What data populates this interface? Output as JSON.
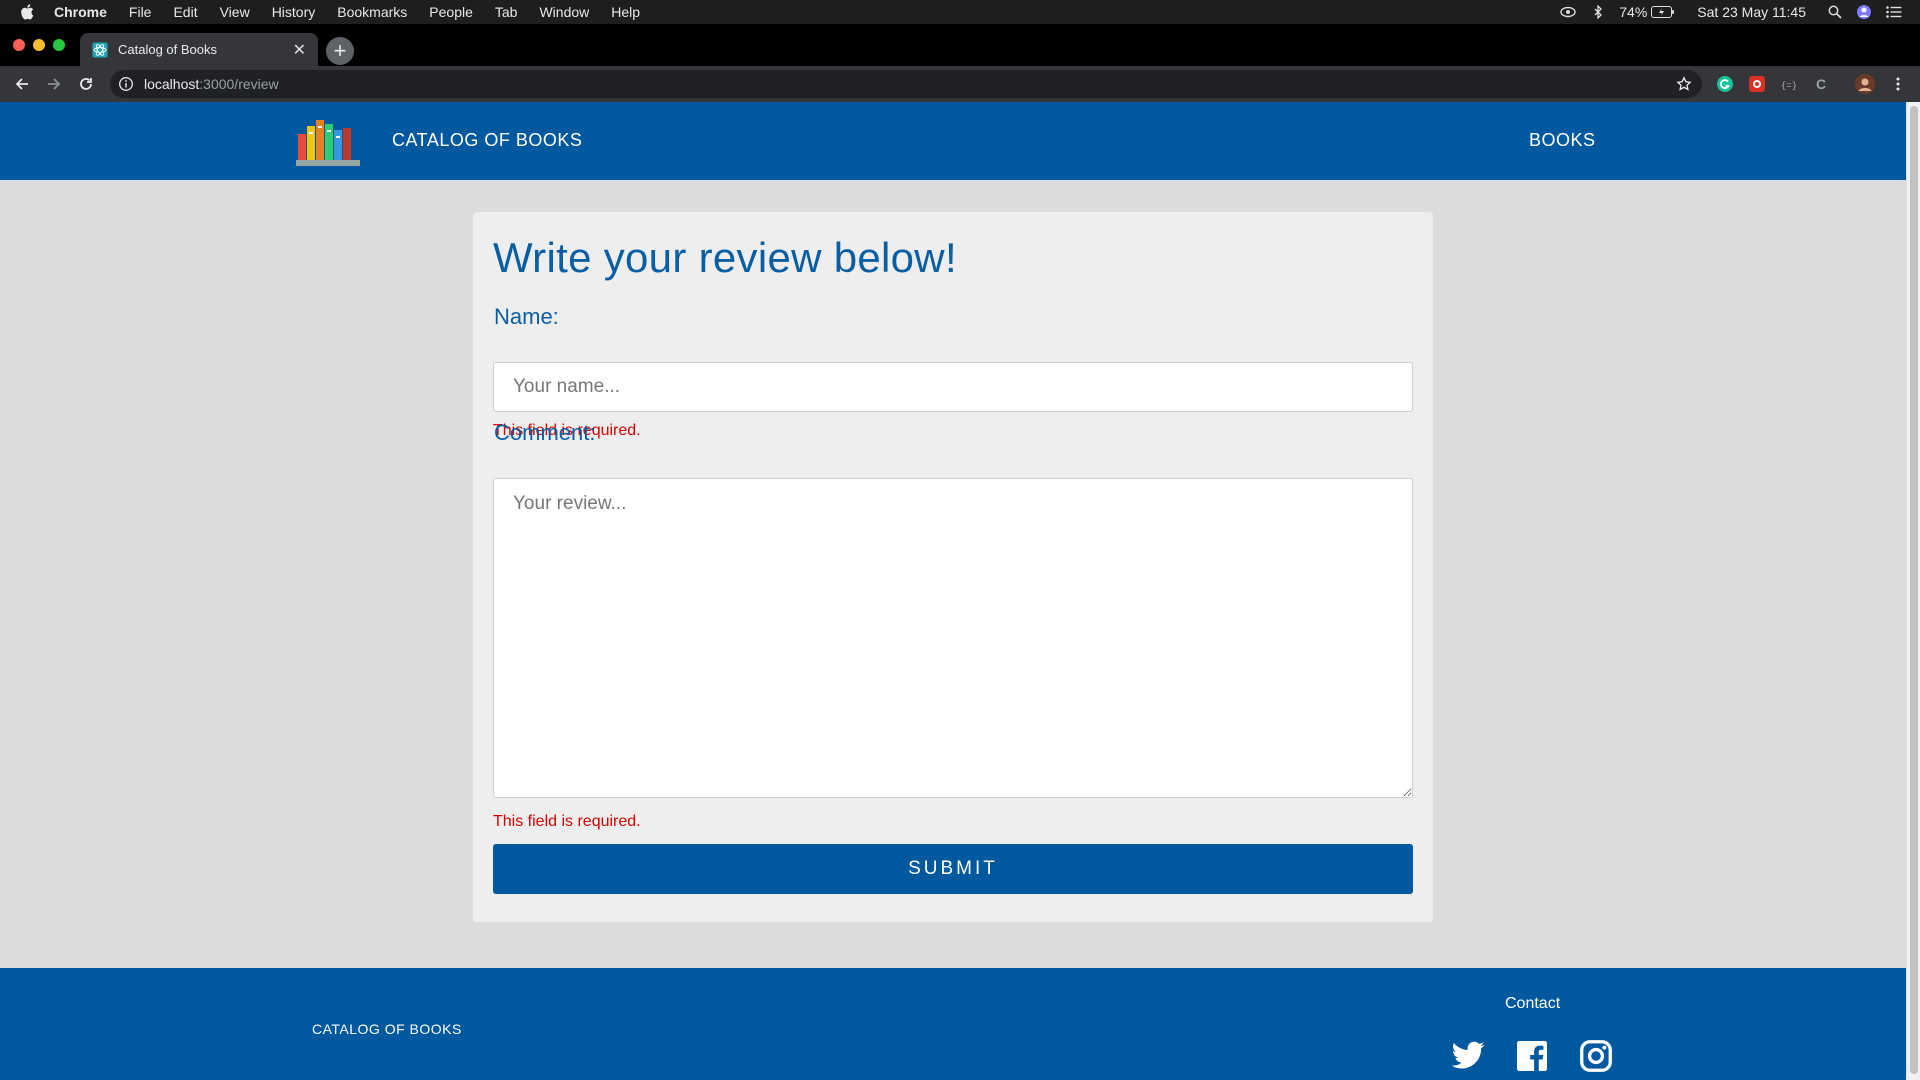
{
  "menubar": {
    "app": "Chrome",
    "items": [
      "File",
      "Edit",
      "View",
      "History",
      "Bookmarks",
      "People",
      "Tab",
      "Window",
      "Help"
    ],
    "battery": "74%",
    "clock": "Sat 23 May  11:45"
  },
  "browser": {
    "tab_title": "Catalog of Books",
    "url_host": "localhost",
    "url_rest": ":3000/review"
  },
  "nav": {
    "brand": "CATALOG OF BOOKS",
    "books_link": "BOOKS"
  },
  "form": {
    "heading": "Write your review below!",
    "name_label": "Name:",
    "name_placeholder": "Your name...",
    "name_error": "This field is required.",
    "comment_label": "Comment:",
    "comment_placeholder": "Your review...",
    "comment_error": "This field is required.",
    "submit_label": "SUBMIT"
  },
  "footer": {
    "brand": "CATALOG OF BOOKS",
    "contact": "Contact",
    "social": [
      "twitter-icon",
      "facebook-icon",
      "instagram-icon"
    ]
  },
  "colors": {
    "primary": "#00589f",
    "heading": "#0a5fa3",
    "error": "#d60000",
    "page_bg": "#dcdcdc",
    "card_bg": "#eeeeee"
  }
}
